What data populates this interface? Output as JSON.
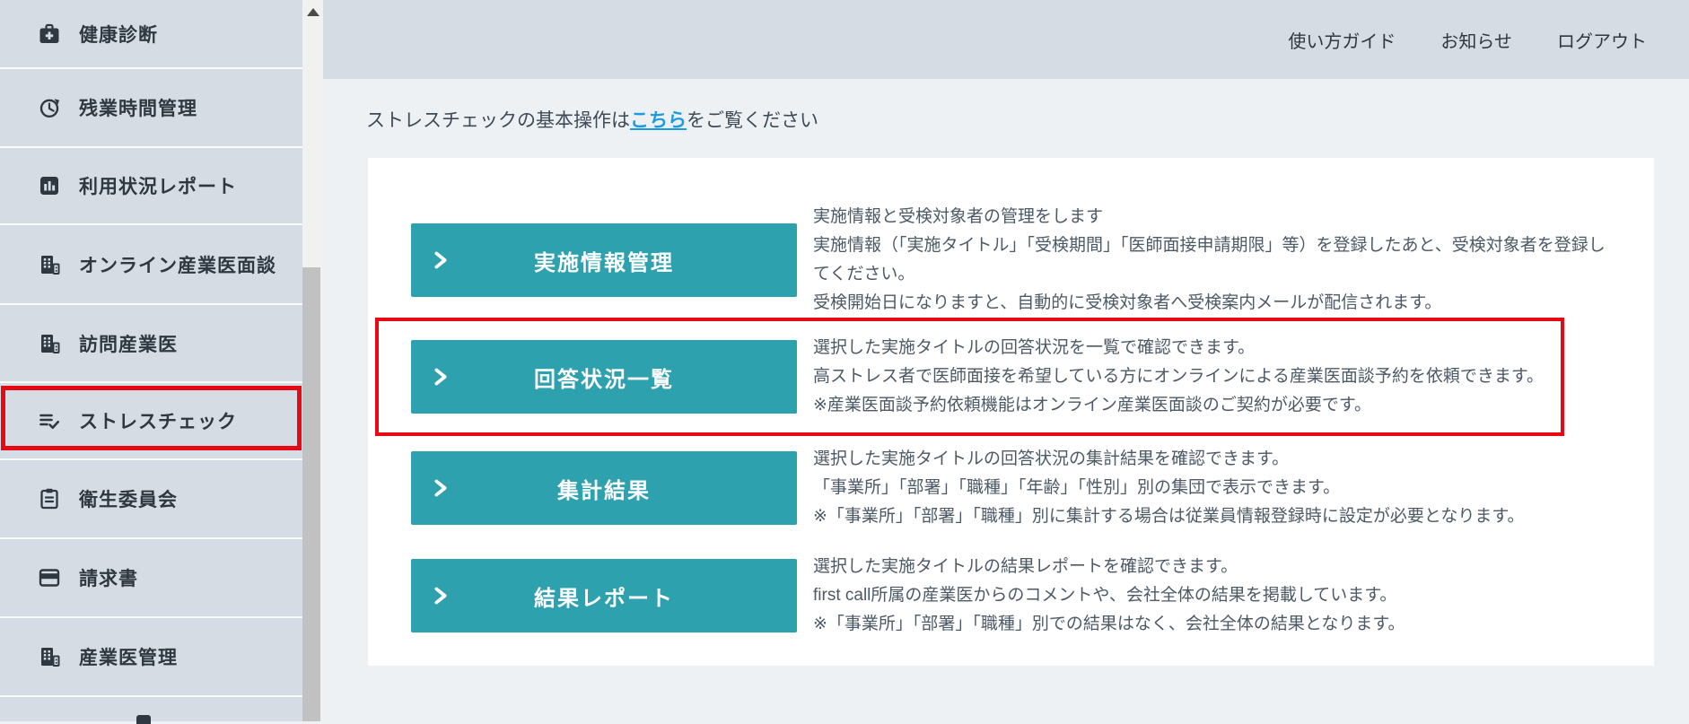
{
  "header": {
    "links": [
      {
        "label": "使い方ガイド"
      },
      {
        "label": "お知らせ"
      },
      {
        "label": "ログアウト"
      }
    ]
  },
  "sidebar": {
    "items": [
      {
        "label": "健康診断",
        "icon": "first-aid-kit-icon"
      },
      {
        "label": "残業時間管理",
        "icon": "clock-history-icon"
      },
      {
        "label": "利用状況レポート",
        "icon": "bar-chart-icon"
      },
      {
        "label": "オンライン産業医面談",
        "icon": "building-icon"
      },
      {
        "label": "訪問産業医",
        "icon": "building-icon"
      },
      {
        "label": "ストレスチェック",
        "icon": "list-check-icon",
        "highlighted": true
      },
      {
        "label": "衛生委員会",
        "icon": "clipboard-icon"
      },
      {
        "label": "請求書",
        "icon": "invoice-icon"
      },
      {
        "label": "産業医管理",
        "icon": "building-icon"
      }
    ]
  },
  "intro": {
    "prefix": "ストレスチェックの基本操作は",
    "link_text": "こちら",
    "suffix": "をご覧ください"
  },
  "menu": {
    "rows": [
      {
        "button_label": "実施情報管理",
        "highlighted": false,
        "description_lines": [
          "実施情報と受検対象者の管理をします",
          "実施情報（「実施タイトル」「受検期間」「医師面接申請期限」等）を登録したあと、受検対象者を登録し",
          "てください。",
          "受検開始日になりますと、自動的に受検対象者へ受検案内メールが配信されます。"
        ]
      },
      {
        "button_label": "回答状況一覧",
        "highlighted": true,
        "description_lines": [
          "選択した実施タイトルの回答状況を一覧で確認できます。",
          "高ストレス者で医師面接を希望している方にオンラインによる産業医面談予約を依頼できます。",
          "※産業医面談予約依頼機能はオンライン産業医面談のご契約が必要です。"
        ]
      },
      {
        "button_label": "集計結果",
        "highlighted": false,
        "description_lines": [
          "選択した実施タイトルの回答状況の集計結果を確認できます。",
          "「事業所」「部署」「職種」「年齢」「性別」別の集団で表示できます。",
          "※「事業所」「部署」「職種」別に集計する場合は従業員情報登録時に設定が必要となります。"
        ]
      },
      {
        "button_label": "結果レポート",
        "highlighted": false,
        "description_lines": [
          "選択した実施タイトルの結果レポートを確認できます。",
          "first call所属の産業医からのコメントや、会社全体の結果を掲載しています。",
          "※「事業所」「部署」「職種」別での結果はなく、会社全体の結果となります。"
        ]
      }
    ]
  },
  "colors": {
    "accent_teal": "#2EA1AF",
    "highlight_red": "#E60914",
    "link_blue": "#1D9CDC",
    "sidebar_bg": "#D5DCE4",
    "main_bg": "#EEF1F4"
  }
}
